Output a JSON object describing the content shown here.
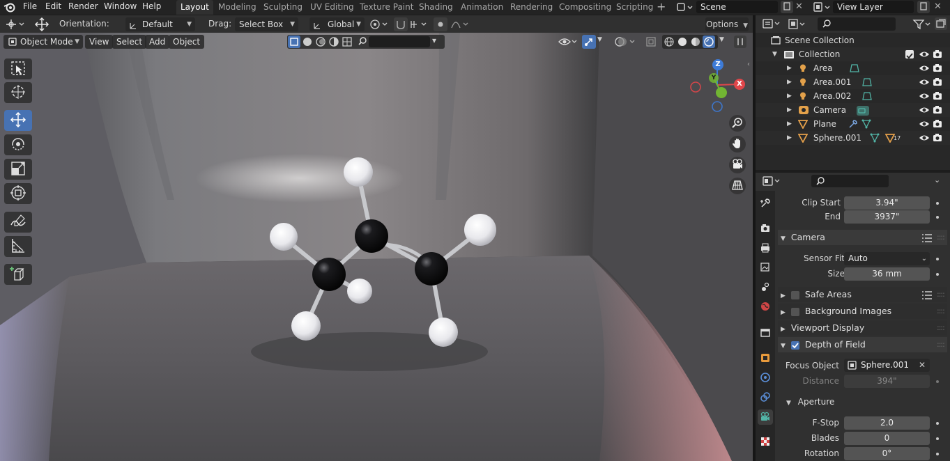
{
  "menubar": {
    "menus": [
      "File",
      "Edit",
      "Render",
      "Window",
      "Help"
    ],
    "workspaces": [
      "Layout",
      "Modeling",
      "Sculpting",
      "UV Editing",
      "Texture Paint",
      "Shading",
      "Animation",
      "Rendering",
      "Compositing",
      "Scripting"
    ],
    "scene_label": "Scene",
    "view_layer_label": "View Layer"
  },
  "tool_header": {
    "orientation_label": "Orientation:",
    "orientation_value": "Default",
    "drag_label": "Drag:",
    "drag_value": "Select Box",
    "transform_orientation": "Global",
    "options_label": "Options"
  },
  "viewport_header": {
    "mode": "Object Mode",
    "menus": [
      "View",
      "Select",
      "Add",
      "Object"
    ]
  },
  "gizmo": {
    "axes": [
      "X",
      "Y",
      "Z"
    ]
  },
  "outliner": {
    "root": "Scene Collection",
    "collection": "Collection",
    "items": [
      {
        "name": "Area",
        "type": "light"
      },
      {
        "name": "Area.001",
        "type": "light"
      },
      {
        "name": "Area.002",
        "type": "light"
      },
      {
        "name": "Camera",
        "type": "camera"
      },
      {
        "name": "Plane",
        "type": "mesh"
      },
      {
        "name": "Sphere.001",
        "type": "mesh",
        "badge": "17"
      }
    ]
  },
  "properties": {
    "clip_start_label": "Clip Start",
    "clip_start_value": "3.94\"",
    "clip_end_label": "End",
    "clip_end_value": "3937\"",
    "camera_panel": "Camera",
    "sensor_fit_label": "Sensor Fit",
    "sensor_fit_value": "Auto",
    "size_label": "Size",
    "size_value": "36 mm",
    "safe_areas": "Safe Areas",
    "background_images": "Background Images",
    "viewport_display": "Viewport Display",
    "depth_of_field": "Depth of Field",
    "focus_object_label": "Focus Object",
    "focus_object_value": "Sphere.001",
    "distance_label": "Distance",
    "distance_value": "394\"",
    "aperture_panel": "Aperture",
    "fstop_label": "F-Stop",
    "fstop_value": "2.0",
    "blades_label": "Blades",
    "blades_value": "0",
    "rotation_label": "Rotation",
    "rotation_value": "0°"
  },
  "colors": {
    "accent": "#4772b3",
    "light_icon": "#e3a14a",
    "camera_icon": "#52b5a7",
    "mesh_icon": "#e5a04a",
    "axis_x": "#e0464a",
    "axis_y": "#72b533",
    "axis_z": "#3d7bd8"
  }
}
